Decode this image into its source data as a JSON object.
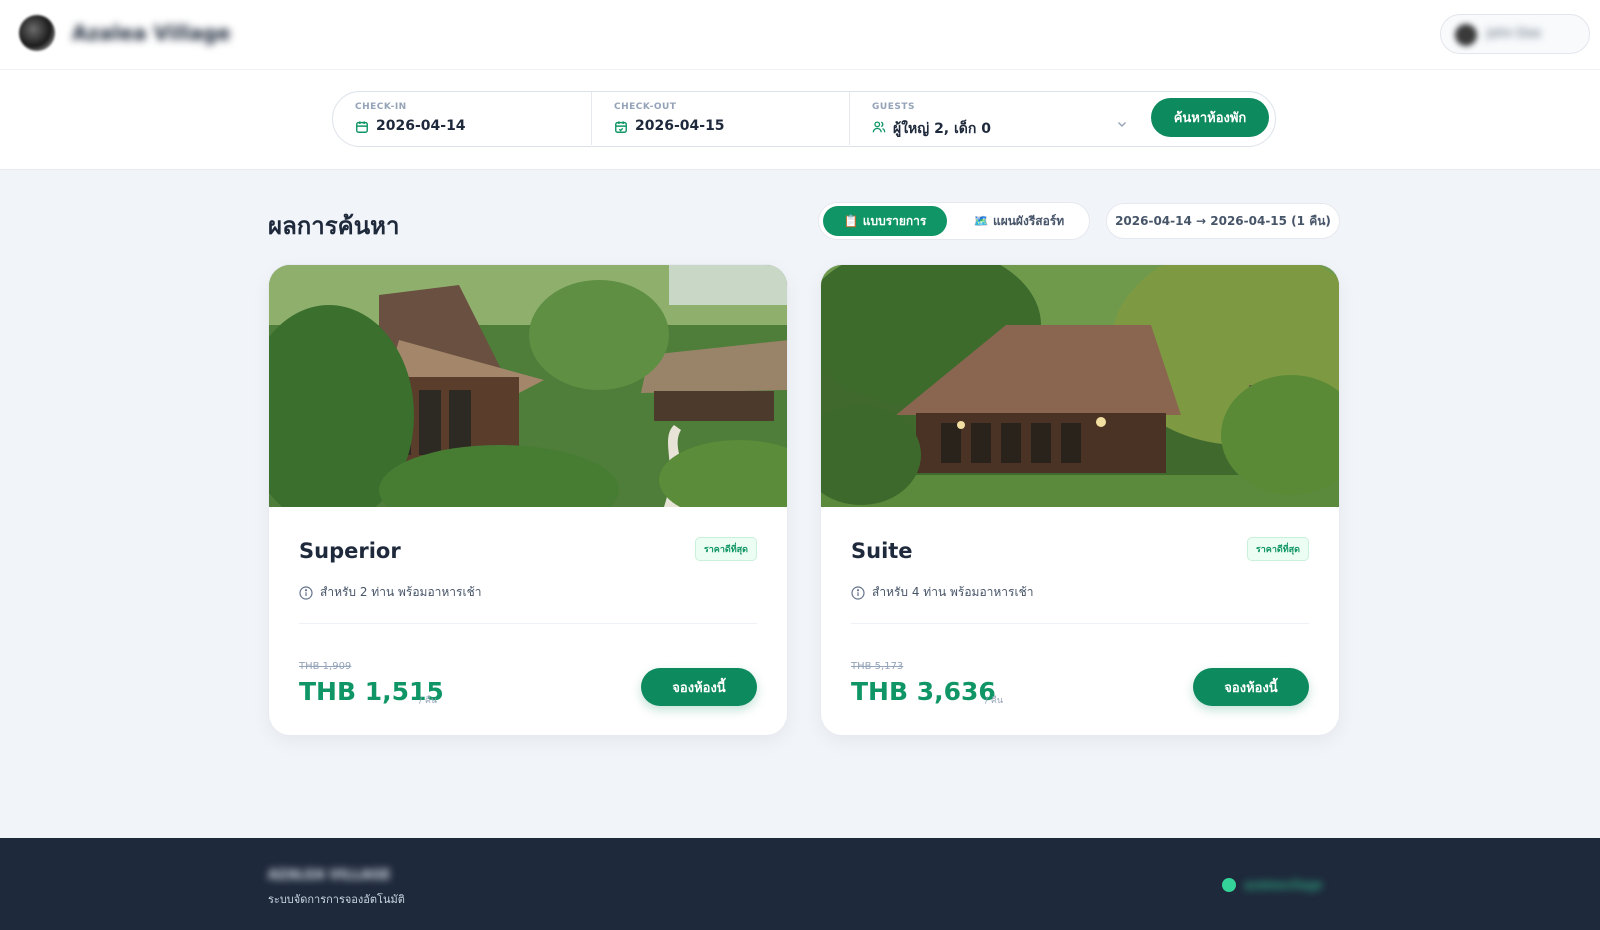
{
  "header": {
    "brand": "Azalea Village",
    "user_name": "John Doe"
  },
  "search": {
    "checkin_label": "CHECK-IN",
    "checkin_value": "2026-04-14",
    "checkout_label": "CHECK-OUT",
    "checkout_value": "2026-04-15",
    "guests_label": "GUESTS",
    "guests_value": "ผู้ใหญ่ 2, เด็ก 0",
    "button": "ค้นหาห้องพัก"
  },
  "results": {
    "title": "ผลการค้นหา",
    "view_list": "📋 แบบรายการ",
    "view_map": "🗺️ แผนผังรีสอร์ท",
    "date_range": "2026-04-14 → 2026-04-15 (1 คืน)"
  },
  "rooms": [
    {
      "name": "Superior",
      "badge": "ราคาดีที่สุด",
      "capacity": "สำหรับ 2 ท่าน พร้อมอาหารเช้า",
      "old_price": "THB 1,909",
      "price": "THB 1,515",
      "per": "/ คืน",
      "button": "จองห้องนี้"
    },
    {
      "name": "Suite",
      "badge": "ราคาดีที่สุด",
      "capacity": "สำหรับ 4 ท่าน พร้อมอาหารเช้า",
      "old_price": "THB 5,173",
      "price": "THB 3,636",
      "per": "/ คืน",
      "button": "จองห้องนี้"
    }
  ],
  "footer": {
    "brand": "AZALEA VILLAGE",
    "subtitle": "ระบบจัดการการจองอัตโนมัติ",
    "contact": "azaleavillage"
  },
  "colors": {
    "accent": "#109666",
    "button": "#0e8a5f",
    "footer_bg": "#1e293b",
    "page_bg": "#f1f4f8"
  },
  "icons": {
    "checkin": "calendar-icon",
    "checkout": "calendar-check-icon",
    "guests": "users-icon",
    "dropdown": "chevron-down-icon",
    "capacity": "info-icon",
    "contact": "chat-icon"
  }
}
